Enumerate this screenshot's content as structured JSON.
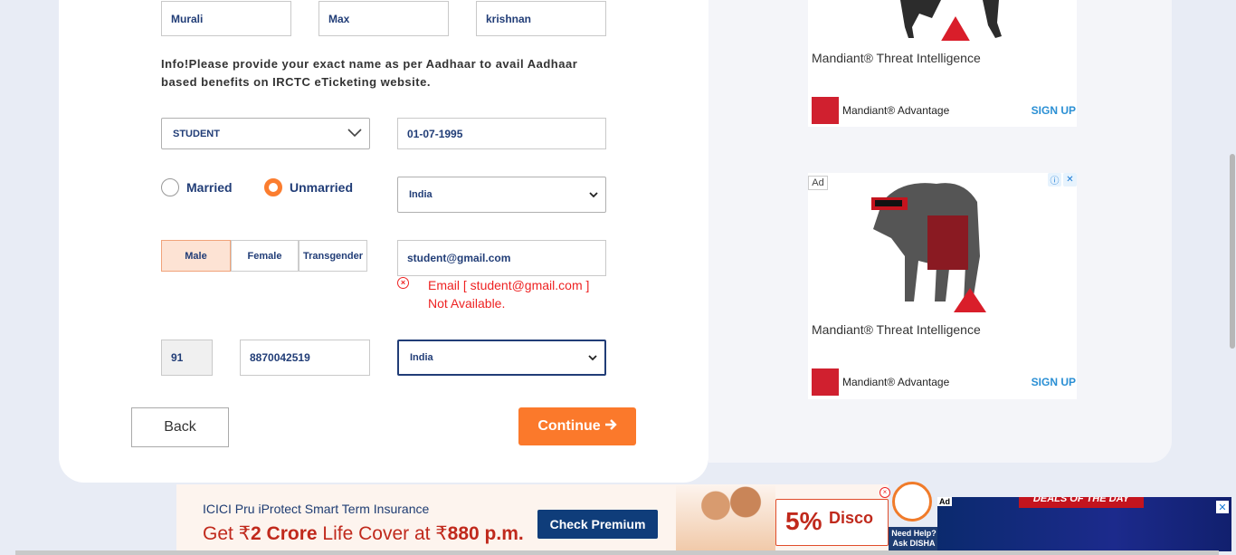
{
  "name": {
    "first": "Murali",
    "middle": "Max",
    "last": "krishnan"
  },
  "info_text": "Info!Please provide your exact name as per Aadhaar to avail Aadhaar based benefits on IRCTC eTicketing website.",
  "occupation": {
    "selected": "STUDENT"
  },
  "dob": "01-07-1995",
  "marital": {
    "married_label": "Married",
    "unmarried_label": "Unmarried",
    "selected": "Unmarried"
  },
  "country_select": {
    "selected": "India"
  },
  "gender": {
    "options": [
      "Male",
      "Female",
      "Transgender"
    ],
    "selected": "Male"
  },
  "email": {
    "value": "student@gmail.com",
    "error": "Email [ student@gmail.com ] Not Available."
  },
  "mobile": {
    "isd": "91",
    "number": "8870042519",
    "nationality": "India"
  },
  "buttons": {
    "back": "Back",
    "continue": "Continue"
  },
  "ads": {
    "ad1": {
      "title": "Mandiant® Threat Intelligence",
      "brand": "Mandiant® Advantage",
      "cta": "SIGN UP"
    },
    "ad2": {
      "badge": "Ad",
      "title": "Mandiant® Threat Intelligence",
      "brand": "Mandiant® Advantage",
      "cta": "SIGN UP"
    },
    "bottom": {
      "line1": "ICICI Pru iProtect Smart Term Insurance",
      "line2_pre": "Get ₹",
      "line2_amount": "2 Crore",
      "line2_mid": " Life Cover at ₹",
      "line2_price": "880 p.m.",
      "cta": "Check Premium",
      "promo": "5%",
      "promo2": "Disco"
    },
    "disha": "Need Help? Ask DISHA",
    "deal": {
      "label": "Ad",
      "banner": "DEALS OF THE DAY"
    }
  },
  "colors": {
    "accent": "#fb792b",
    "navy": "#213d77",
    "error": "#e22222"
  }
}
